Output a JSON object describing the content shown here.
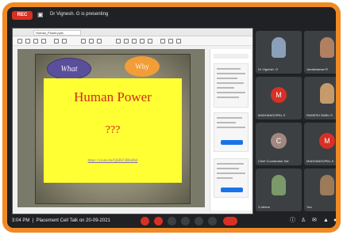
{
  "topbar": {
    "rec_label": "REC",
    "presenting_text": "Dr Vignesh. G is presenting"
  },
  "app": {
    "tab_label": "Human_Power.pptx"
  },
  "slide": {
    "bubble_what": "What",
    "bubble_why": "Why",
    "title": "Human Power",
    "question": "???",
    "link": "https://youtu.be/QkBrC8Bn8b4"
  },
  "participants": [
    {
      "name": "Dr Vignesh. G",
      "type": "photo",
      "color": "#8aa0b8"
    },
    {
      "name": "Janakiraman R",
      "type": "photo",
      "color": "#b08060"
    },
    {
      "name": "MADHANGOPAL K",
      "type": "letter",
      "letter": "M",
      "color": "#d93025"
    },
    {
      "name": "RAMESH BABU S",
      "type": "photo",
      "color": "#c79a6b"
    },
    {
      "name": "Chief Coordinator Saf",
      "type": "letter",
      "letter": "C",
      "color": "#a1887f"
    },
    {
      "name": "MADHANGOPAL K",
      "type": "letter",
      "letter": "M",
      "color": "#d93025"
    },
    {
      "name": "V-others",
      "type": "photo",
      "color": "#7a9a6a"
    },
    {
      "name": "You",
      "type": "photo",
      "color": "#9c7a5a"
    }
  ],
  "bottombar": {
    "time_text": "3:04 PM",
    "meeting_title": "Placement Cell Talk on 20-09-2021"
  },
  "colors": {
    "frame": "#f08a24",
    "meet_bg": "#202124",
    "tile_bg": "#3c4043",
    "danger": "#d93025",
    "slide_yellow": "#ffff33",
    "slide_text": "#d12a1c"
  }
}
